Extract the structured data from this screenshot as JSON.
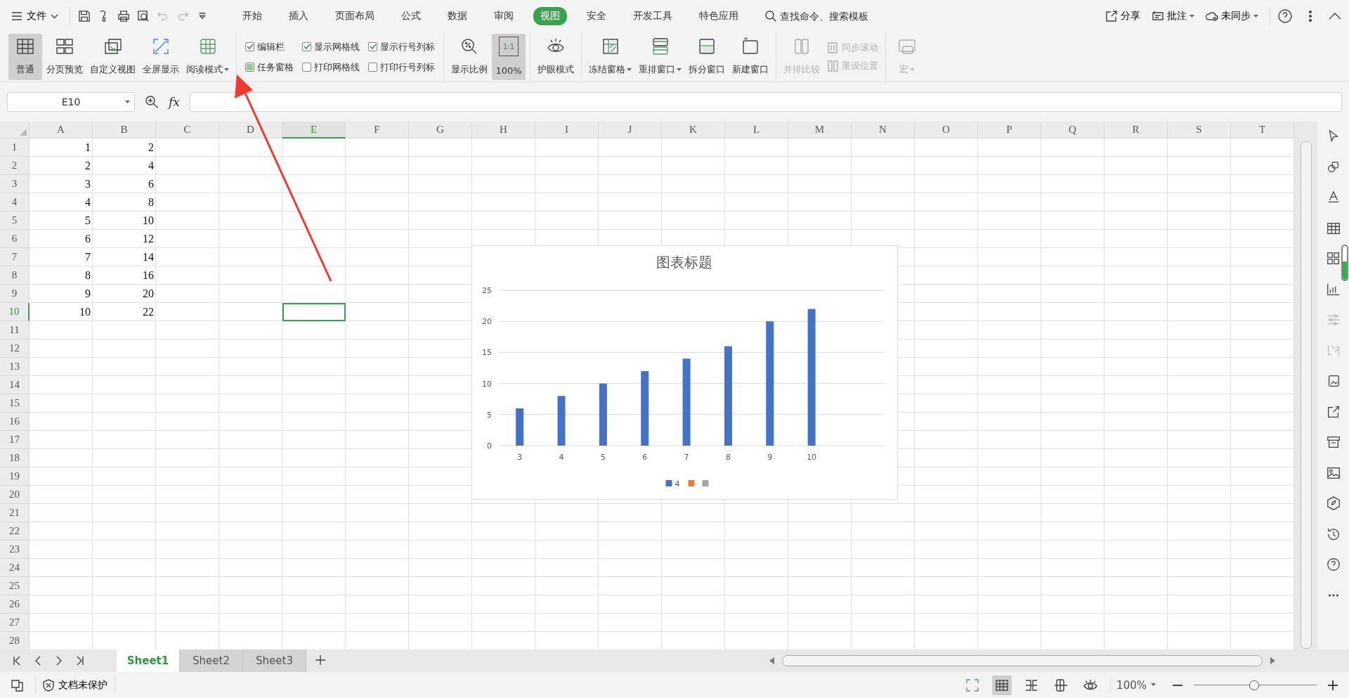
{
  "menu_bar": {
    "file_menu": "文件",
    "quick_access": [
      {
        "disabled": false
      },
      {
        "disabled": false
      },
      {
        "disabled": false
      },
      {
        "disabled": false
      },
      {
        "disabled": true
      },
      {
        "disabled": true
      },
      {
        "disabled": false
      }
    ],
    "tabs": [
      {
        "label": "开始",
        "selected": false
      },
      {
        "label": "插入",
        "selected": false
      },
      {
        "label": "页面布局",
        "selected": false
      },
      {
        "label": "公式",
        "selected": false
      },
      {
        "label": "数据",
        "selected": false
      },
      {
        "label": "审阅",
        "selected": false
      },
      {
        "label": "视图",
        "selected": true
      },
      {
        "label": "安全",
        "selected": false
      },
      {
        "label": "开发工具",
        "selected": false
      },
      {
        "label": "特色应用",
        "selected": false
      }
    ],
    "search": {
      "placeholder": "查找命令、搜索模板"
    },
    "actions": [
      {
        "label": "分享",
        "dropdown": false
      },
      {
        "label": "批注",
        "dropdown": true
      },
      {
        "label": "未同步",
        "dropdown": true
      }
    ]
  },
  "ribbon": [
    [
      {
        "kind": "big",
        "label": "普通",
        "selected": true,
        "dropdown": false,
        "disabled": false
      },
      {
        "kind": "big",
        "label": "分页预览",
        "selected": false,
        "dropdown": false,
        "disabled": false
      },
      {
        "kind": "big",
        "label": "自定义视图",
        "selected": false,
        "dropdown": false,
        "disabled": false
      },
      {
        "kind": "big",
        "label": "全屏显示",
        "selected": false,
        "dropdown": false,
        "disabled": false
      },
      {
        "kind": "big",
        "label": "阅读模式",
        "selected": false,
        "dropdown": true,
        "disabled": false
      }
    ],
    [
      {
        "kind": "check",
        "label": "编辑栏",
        "checked": true,
        "partial": false
      },
      {
        "kind": "check",
        "label": "任务窗格",
        "checked": false,
        "partial": true
      },
      {
        "kind": "check",
        "label": "显示网格线",
        "checked": true,
        "partial": false
      },
      {
        "kind": "check",
        "label": "打印网格线",
        "checked": false,
        "partial": false
      },
      {
        "kind": "check",
        "label": "显示行号列标",
        "checked": true,
        "partial": false
      },
      {
        "kind": "check",
        "label": "打印行号列标",
        "checked": false,
        "partial": false
      }
    ],
    [
      {
        "kind": "big",
        "label": "显示比例",
        "selected": false,
        "dropdown": false,
        "disabled": false
      },
      {
        "kind": "big",
        "label": "100%",
        "icon_text": "1:1",
        "selected": true,
        "dropdown": false,
        "disabled": false
      }
    ],
    [
      {
        "kind": "big",
        "label": "护眼模式",
        "selected": false,
        "dropdown": false,
        "disabled": false
      }
    ],
    [
      {
        "kind": "big",
        "label": "冻结窗格",
        "selected": false,
        "dropdown": true,
        "disabled": false
      },
      {
        "kind": "big",
        "label": "重排窗口",
        "selected": false,
        "dropdown": true,
        "disabled": false
      },
      {
        "kind": "big",
        "label": "拆分窗口",
        "selected": false,
        "dropdown": false,
        "disabled": false
      },
      {
        "kind": "big",
        "label": "新建窗口",
        "selected": false,
        "dropdown": false,
        "disabled": false
      }
    ],
    [
      {
        "kind": "big",
        "label": "并排比较",
        "selected": false,
        "dropdown": false,
        "disabled": true
      },
      {
        "kind": "small",
        "label": "同步滚动",
        "disabled": true
      },
      {
        "kind": "small",
        "label": "重设位置",
        "disabled": true
      }
    ],
    [
      {
        "kind": "big",
        "label": "宏",
        "selected": false,
        "dropdown": true,
        "disabled": true
      }
    ]
  ],
  "formula_bar": {
    "name_box": "E10",
    "fx_label": "fx"
  },
  "sheet": {
    "columns": [
      {
        "label": "A",
        "selected": false
      },
      {
        "label": "B",
        "selected": false
      },
      {
        "label": "C",
        "selected": false
      },
      {
        "label": "D",
        "selected": false
      },
      {
        "label": "E",
        "selected": true
      },
      {
        "label": "F",
        "selected": false
      },
      {
        "label": "G",
        "selected": false
      },
      {
        "label": "H",
        "selected": false
      },
      {
        "label": "I",
        "selected": false
      },
      {
        "label": "J",
        "selected": false
      },
      {
        "label": "K",
        "selected": false
      },
      {
        "label": "L",
        "selected": false
      },
      {
        "label": "M",
        "selected": false
      },
      {
        "label": "N",
        "selected": false
      },
      {
        "label": "O",
        "selected": false
      },
      {
        "label": "P",
        "selected": false
      },
      {
        "label": "Q",
        "selected": false
      },
      {
        "label": "R",
        "selected": false
      },
      {
        "label": "S",
        "selected": false
      },
      {
        "label": "T",
        "selected": false
      }
    ],
    "rows": [
      {
        "label": "1",
        "selected": false,
        "cells": [
          "1",
          "2"
        ]
      },
      {
        "label": "2",
        "selected": false,
        "cells": [
          "2",
          "4"
        ]
      },
      {
        "label": "3",
        "selected": false,
        "cells": [
          "3",
          "6"
        ]
      },
      {
        "label": "4",
        "selected": false,
        "cells": [
          "4",
          "8"
        ]
      },
      {
        "label": "5",
        "selected": false,
        "cells": [
          "5",
          "10"
        ]
      },
      {
        "label": "6",
        "selected": false,
        "cells": [
          "6",
          "12"
        ]
      },
      {
        "label": "7",
        "selected": false,
        "cells": [
          "7",
          "14"
        ]
      },
      {
        "label": "8",
        "selected": false,
        "cells": [
          "8",
          "16"
        ]
      },
      {
        "label": "9",
        "selected": false,
        "cells": [
          "9",
          "20"
        ]
      },
      {
        "label": "10",
        "selected": true,
        "cells": [
          "10",
          "22"
        ]
      },
      {
        "label": "11",
        "selected": false
      },
      {
        "label": "12",
        "selected": false
      },
      {
        "label": "13",
        "selected": false
      },
      {
        "label": "14",
        "selected": false
      },
      {
        "label": "15",
        "selected": false
      },
      {
        "label": "16",
        "selected": false
      },
      {
        "label": "17",
        "selected": false
      },
      {
        "label": "18",
        "selected": false
      },
      {
        "label": "19",
        "selected": false
      },
      {
        "label": "20",
        "selected": false
      },
      {
        "label": "21",
        "selected": false
      },
      {
        "label": "22",
        "selected": false
      },
      {
        "label": "23",
        "selected": false
      },
      {
        "label": "24",
        "selected": false
      },
      {
        "label": "25",
        "selected": false
      },
      {
        "label": "26",
        "selected": false
      },
      {
        "label": "27",
        "selected": false
      },
      {
        "label": "28",
        "selected": false
      }
    ],
    "chart": {
      "chart_data": {
        "type": "bar",
        "title": "图表标题",
        "categories": [
          "3",
          "4",
          "5",
          "6",
          "7",
          "8",
          "9",
          "10"
        ],
        "series": [
          {
            "name": "4",
            "color": "#4472c4",
            "values": [
              6,
              8,
              10,
              12,
              14,
              16,
              20,
              22
            ]
          }
        ],
        "ylim": [
          0,
          25
        ],
        "yticks": [
          0,
          5,
          10,
          15,
          20,
          25
        ],
        "grid": true
      },
      "extra_legend_swatches": [
        {
          "color": "#ed7d31"
        },
        {
          "color": "#a5a5a5"
        }
      ]
    }
  },
  "side_panel": [
    {
      "disabled": false
    },
    {
      "disabled": false
    },
    {
      "disabled": false
    },
    {
      "disabled": false
    },
    {
      "disabled": false
    },
    {
      "disabled": false
    },
    {
      "disabled": true
    },
    {
      "disabled": true
    },
    {
      "disabled": false
    },
    {
      "disabled": false
    },
    {
      "disabled": false
    },
    {
      "disabled": false
    },
    {
      "disabled": false
    },
    {
      "disabled": false
    },
    {
      "disabled": false
    },
    {
      "disabled": false
    }
  ],
  "sheet_tabs": [
    {
      "label": "Sheet1",
      "selected": true
    },
    {
      "label": "Sheet2",
      "selected": false
    },
    {
      "label": "Sheet3",
      "selected": false
    }
  ],
  "status_bar": {
    "protection": "文档未保护",
    "view_buttons": [
      {
        "selected": false
      },
      {
        "selected": true
      },
      {
        "selected": false
      },
      {
        "selected": false
      },
      {
        "selected": false
      }
    ],
    "zoom": "100%",
    "zoom_slider": {
      "level": 0.49
    }
  }
}
